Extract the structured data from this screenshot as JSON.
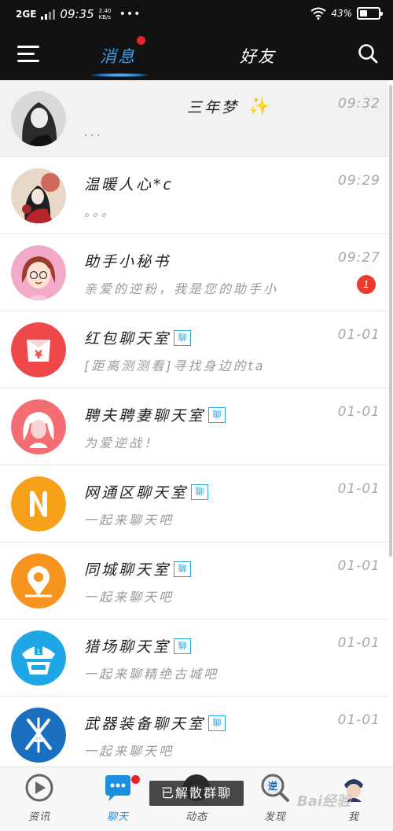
{
  "status_bar": {
    "network": "2G",
    "network_type": "E",
    "time": "09:35",
    "speed": "2.40 KB/s",
    "dots": "•••",
    "battery": "43%",
    "battery_level": 0.43
  },
  "header": {
    "tabs": [
      {
        "label": "消息",
        "active": true,
        "has_dot": true
      },
      {
        "label": "好友",
        "active": false
      }
    ]
  },
  "conversations": [
    {
      "name": "三年梦",
      "preview": "...",
      "time": "09:32",
      "pinned": true,
      "avatar": "grayscale-girl-photo",
      "sparkle": "✨"
    },
    {
      "name": "温暖人心*c",
      "preview": "。。。",
      "time": "09:29",
      "avatar": "illustrated-girl-photo"
    },
    {
      "name": "助手小秘书",
      "preview": "亲爱的逆粉，我是您的助手小",
      "time": "09:27",
      "unread": "1",
      "avatar": "assistant-girl-icon"
    },
    {
      "name": "红包聊天室",
      "badge": "聊",
      "preview": "[距离测测看]寻找身边的ta",
      "time": "01-01",
      "avatar": "red-envelope-icon",
      "color": "#f04848"
    },
    {
      "name": "聘夫聘妻聊天室",
      "badge": "聊",
      "preview": "为爱逆战！",
      "time": "01-01",
      "avatar": "woman-face-icon",
      "color": "#f36d73"
    },
    {
      "name": "网通区聊天室",
      "badge": "聊",
      "preview": "一起来聊天吧",
      "time": "01-01",
      "avatar": "n-logo-icon",
      "color": "#f7a11a"
    },
    {
      "name": "同城聊天室",
      "badge": "聊",
      "preview": "一起来聊天吧",
      "time": "01-01",
      "avatar": "location-pin-icon",
      "color": "#f7941e"
    },
    {
      "name": "猎场聊天室",
      "badge": "聊",
      "preview": "一起来聊精绝古城吧",
      "time": "01-01",
      "avatar": "police-cap-icon",
      "color": "#1ea6e6"
    },
    {
      "name": "武器装备聊天室",
      "badge": "聊",
      "preview": "一起来聊天吧",
      "time": "01-01",
      "avatar": "crossed-weapons-icon",
      "color": "#1a6fc0"
    }
  ],
  "bottom_nav": [
    {
      "label": "资讯",
      "icon": "news-play-icon"
    },
    {
      "label": "聊天",
      "icon": "chat-bubble-icon",
      "active": true,
      "has_dot": true
    },
    {
      "label": "动态",
      "icon": "feed-avatar-icon"
    },
    {
      "label": "发现",
      "icon": "discover-search-icon"
    },
    {
      "label": "我",
      "icon": "profile-icon"
    }
  ],
  "toast": "已解散群聊",
  "watermark": "Bai经验",
  "colors": {
    "accent": "#1d8fe0",
    "header_bg": "#121212",
    "dot_red": "#e8232c"
  }
}
